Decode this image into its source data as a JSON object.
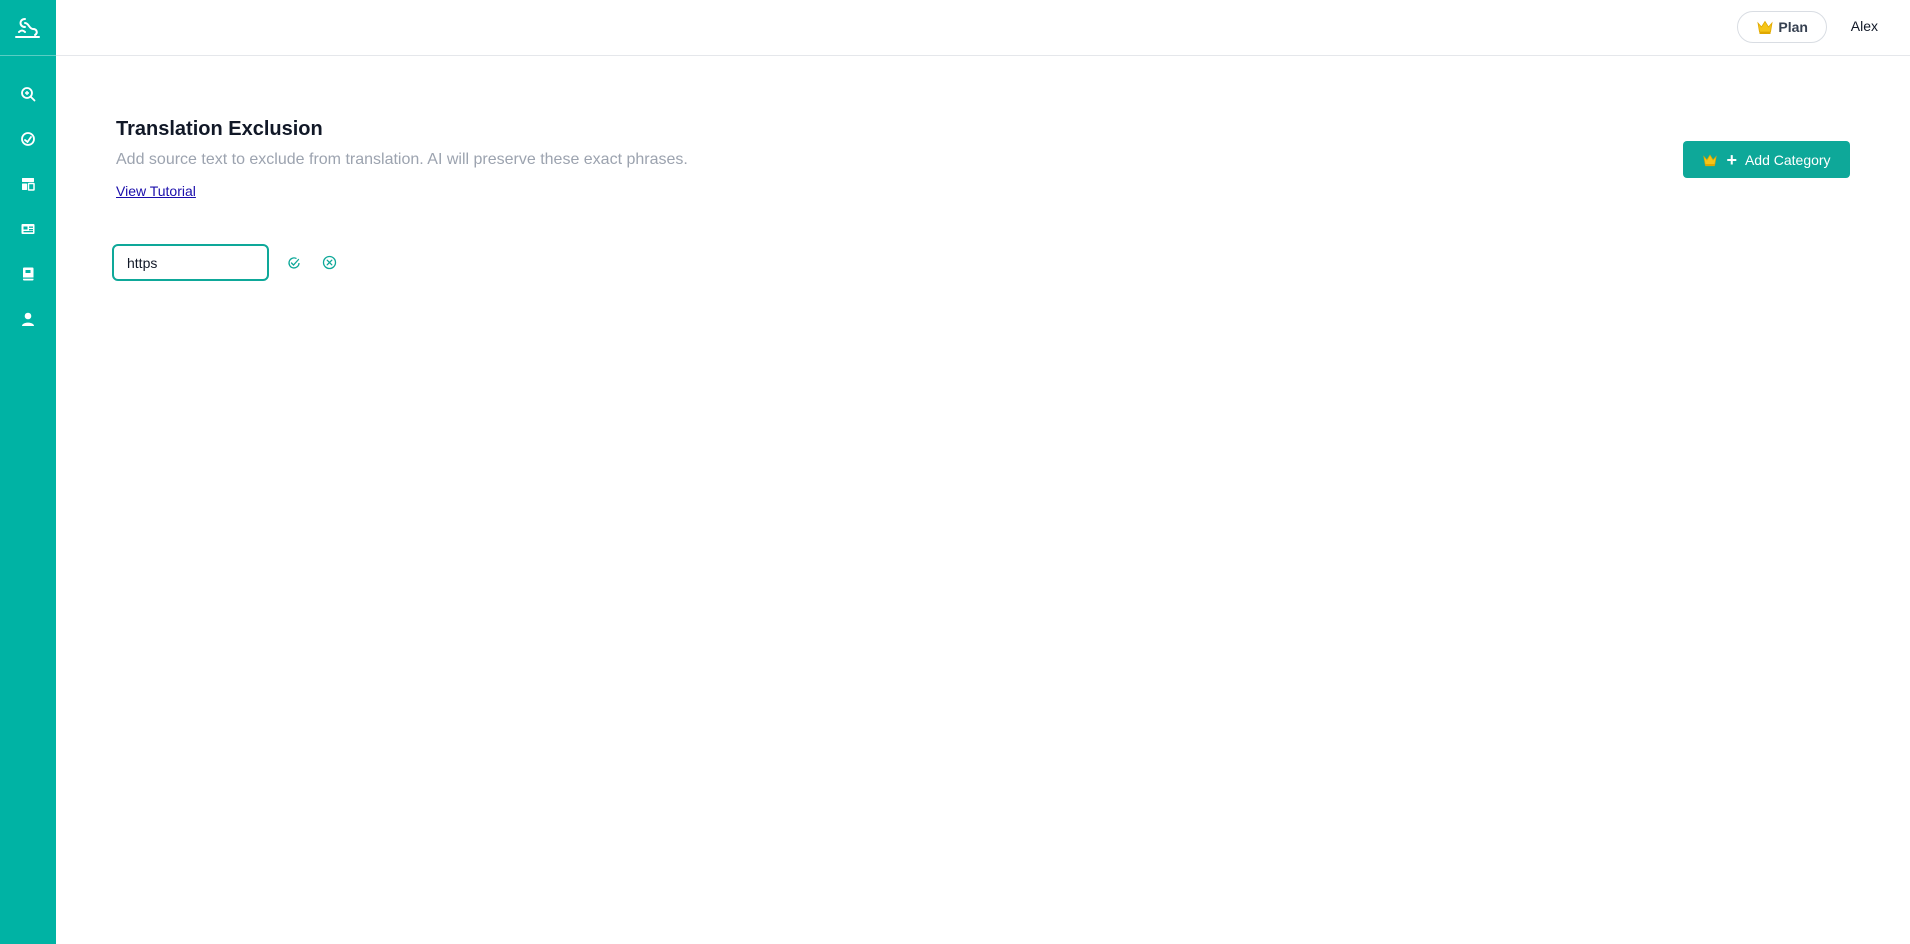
{
  "header": {
    "plan_label": "Plan",
    "user_name": "Alex"
  },
  "sidebar": {
    "items": [
      {
        "icon": "search-zoom-icon"
      },
      {
        "icon": "gauge-icon"
      },
      {
        "icon": "layout-icon"
      },
      {
        "icon": "id-card-icon"
      },
      {
        "icon": "book-icon"
      },
      {
        "icon": "user-icon"
      }
    ]
  },
  "main": {
    "title": "Translation Exclusion",
    "subtitle": "Add source text to exclude from translation. AI will preserve these exact phrases.",
    "tutorial_link": "View Tutorial",
    "add_category_label": "Add Category",
    "input_value": "https"
  },
  "colors": {
    "sidebar": "#00b3a4",
    "accent": "#0ea899",
    "crown": "#f5c518",
    "link": "#1a0dab"
  }
}
